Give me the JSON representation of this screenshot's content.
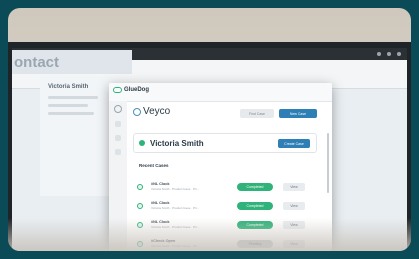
{
  "background": {
    "teal": "#0b4a57"
  },
  "salesforce": {
    "page_title": "ontact",
    "contact_name": "Victoria Smith"
  },
  "gluedog": {
    "logo_text": "GlueDog",
    "colors": {
      "accent": "#2fb37a",
      "primary_button": "#2e7fb5"
    }
  },
  "veyco": {
    "logo_text": "Veyco",
    "button_find": "Find Case",
    "button_new": "New Case"
  },
  "contact": {
    "name": "Victoria Smith",
    "create_button": "Create Case"
  },
  "recent_cases": {
    "title": "Recent Cases",
    "items": [
      {
        "title": "#NL Clock",
        "subtitle": "Victoria Smith · Product Issue · Pri...",
        "status": "Completed",
        "view": "View"
      },
      {
        "title": "#NL Clock",
        "subtitle": "Victoria Smith · Product Issue · Pri...",
        "status": "Completed",
        "view": "View"
      },
      {
        "title": "#NL Clock",
        "subtitle": "Victoria Smith · Product Issue · Pri...",
        "status": "Completed",
        "view": "View"
      },
      {
        "title": "#Check Open",
        "subtitle": "Victoria Smith · Product Issue · Pri...",
        "status": "Pending",
        "view": "View"
      }
    ]
  }
}
